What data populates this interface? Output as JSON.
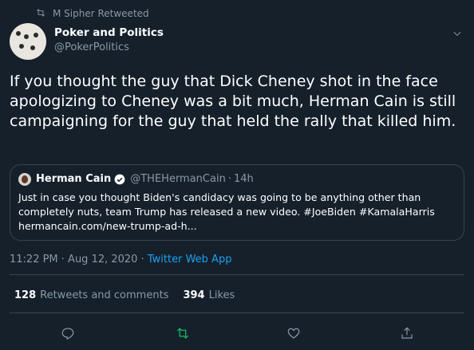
{
  "social_context": {
    "text": "M Sipher Retweeted",
    "icon": "retweet-icon"
  },
  "tweet": {
    "author_name": "Poker and Politics",
    "author_handle": "@PokerPolitics",
    "text": "If you thought the guy that Dick Cheney shot in the face apologizing to Cheney was a bit much, Herman Cain is still campaigning for the guy that held the rally that killed him.",
    "timestamp": "11:22 PM · Aug 12, 2020",
    "meta_sep": " · ",
    "source": "Twitter Web App"
  },
  "quoted_tweet": {
    "author_name": "Herman Cain",
    "author_handle": "@THEHermanCain",
    "separator": "·",
    "time": "14h",
    "text": "Just in case you thought Biden's candidacy was going to be anything other than completely nuts, team Trump has released a new video. #JoeBiden #KamalaHarris hermancain.com/new-trump-ad-h..."
  },
  "stats": {
    "retweets_count": "128",
    "retweets_label": "Retweets and comments",
    "likes_count": "394",
    "likes_label": "Likes"
  },
  "actions": {
    "reply": "reply-icon",
    "retweet": "retweet-icon",
    "like": "heart-icon",
    "share": "share-icon"
  },
  "colors": {
    "background": "#15202b",
    "text_primary": "#ffffff",
    "text_secondary": "#8899a6",
    "accent": "#1da1f2",
    "retweeted_green": "#17bf63",
    "border": "#38444d"
  }
}
